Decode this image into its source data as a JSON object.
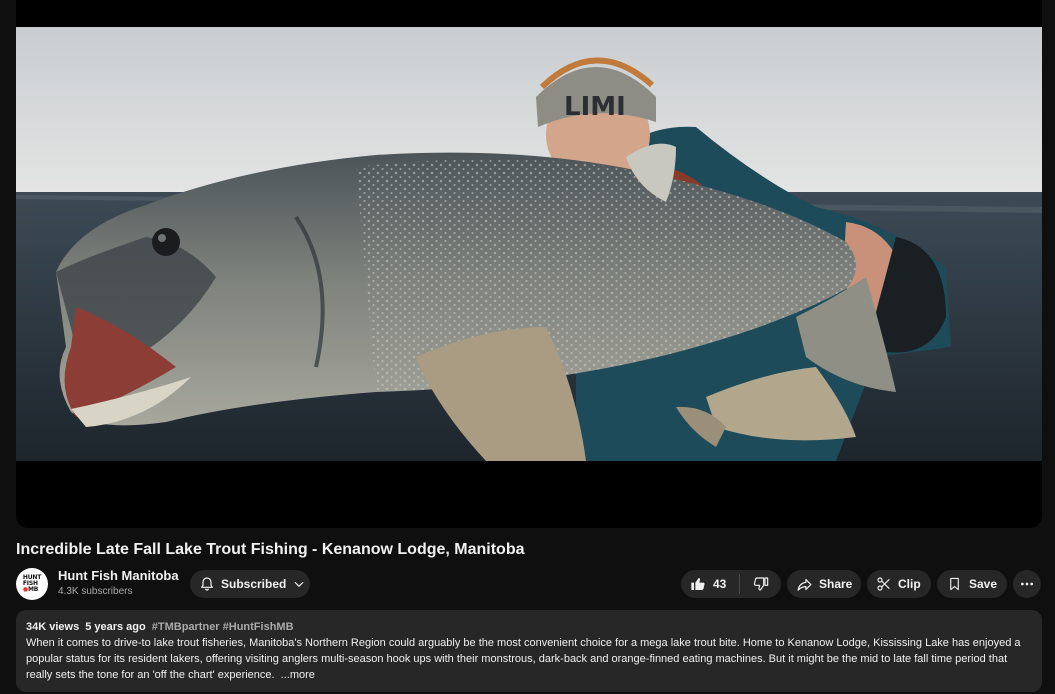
{
  "video": {
    "title": "Incredible Late Fall Lake Trout Fishing - Kenanow Lodge, Manitoba",
    "thumbnail_description": "angler-holding-large-lake-trout-on-water"
  },
  "channel": {
    "name": "Hunt Fish Manitoba",
    "subscribers": "4.3K subscribers",
    "avatar_text": [
      "HUNT",
      "FISH",
      "MB"
    ],
    "subscribe_label": "Subscribed"
  },
  "actions": {
    "like_count": "43",
    "share_label": "Share",
    "clip_label": "Clip",
    "save_label": "Save"
  },
  "description": {
    "views": "34K views",
    "age": "5 years ago",
    "tags": "#TMBpartner #HuntFishMB",
    "text": "When it comes to drive-to lake trout fisheries, Manitoba's Northern Region could arguably be the most convenient choice for a mega lake trout bite.  Home to Kenanow Lodge, Kississing Lake has enjoyed a popular status for its resident lakers, offering visiting anglers multi-season hook ups with their monstrous, dark-back and orange-finned eating machines. But it might be the mid to late fall time period that really sets the tone for an 'off the chart' experience.",
    "more_label": "...more"
  },
  "icons": {
    "subscribe": "bell-icon",
    "subscribe_menu": "chevron-down-icon",
    "like": "thumb-up-icon",
    "dislike": "thumb-down-icon",
    "share": "share-arrow-icon",
    "clip": "scissors-icon",
    "save": "bookmark-icon",
    "more": "ellipsis-icon"
  },
  "colors": {
    "background": "#0f0f0f",
    "button_bg": "#272727",
    "text_primary": "#f1f1f1",
    "text_secondary": "#aaaaaa"
  }
}
